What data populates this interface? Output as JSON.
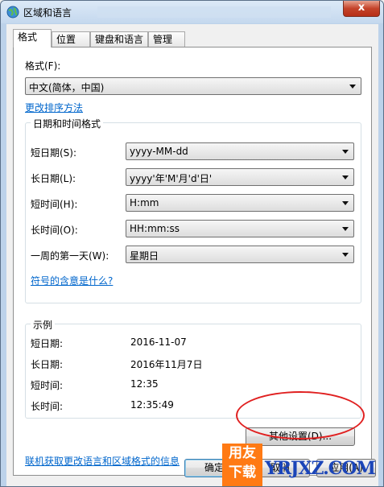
{
  "window": {
    "title": "区域和语言",
    "close_label": "x"
  },
  "tabs": [
    {
      "label": "格式",
      "active": true
    },
    {
      "label": "位置",
      "active": false
    },
    {
      "label": "键盘和语言",
      "active": false
    },
    {
      "label": "管理",
      "active": false
    }
  ],
  "format": {
    "label": "格式(F):",
    "value": "中文(简体，中国)"
  },
  "change_sort_link": "更改排序方法",
  "datetime_group": {
    "title": "日期和时间格式",
    "rows": [
      {
        "label": "短日期(S):",
        "value": "yyyy-MM-dd"
      },
      {
        "label": "长日期(L):",
        "value": "yyyy'年'M'月'd'日'"
      },
      {
        "label": "短时间(H):",
        "value": "H:mm"
      },
      {
        "label": "长时间(O):",
        "value": "HH:mm:ss"
      },
      {
        "label": "一周的第一天(W):",
        "value": "星期日"
      }
    ],
    "symbol_link": "符号的含意是什么?"
  },
  "example_group": {
    "title": "示例",
    "rows": [
      {
        "label": "短日期:",
        "value": "2016-11-07"
      },
      {
        "label": "长日期:",
        "value": "2016年11月7日"
      },
      {
        "label": "短时间:",
        "value": "12:35"
      },
      {
        "label": "长时间:",
        "value": "12:35:49"
      }
    ]
  },
  "other_settings_button": "其他设置(D)...",
  "online_link": "联机获取更改语言和区域格式的信息",
  "footer": {
    "ok": "确定",
    "cancel": "取消",
    "apply": "应用(A)"
  },
  "watermark": {
    "badge_top": "用友",
    "badge_bottom": "下载",
    "site": "YRJXZ.COM"
  },
  "colors": {
    "link": "#0066cc",
    "highlight_circle": "#e02020",
    "watermark_orange": "#ff7a14",
    "watermark_blue": "#1b45b8"
  }
}
